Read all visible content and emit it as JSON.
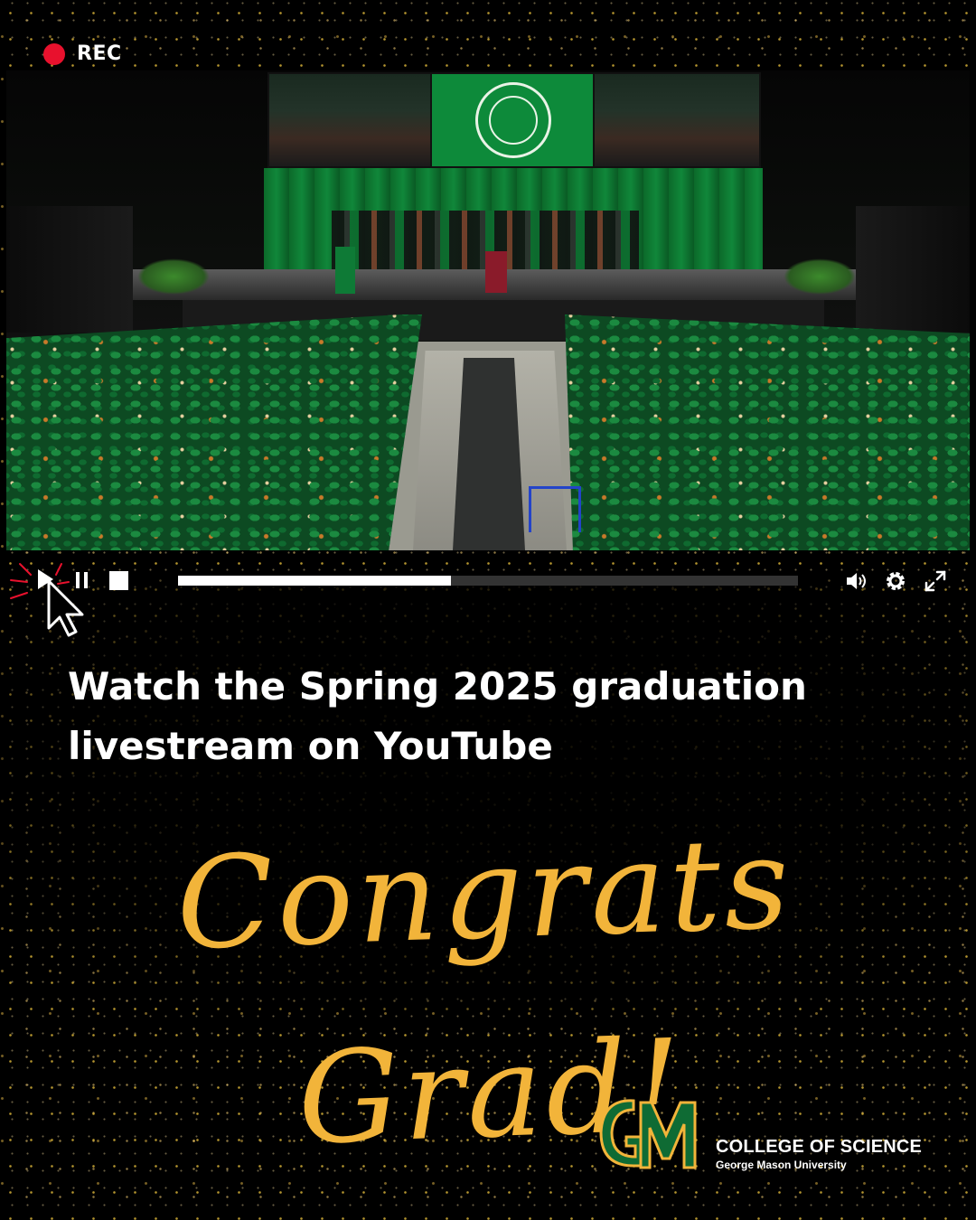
{
  "recording": {
    "label": "REC",
    "color": "#e8112d"
  },
  "video": {
    "description_icons": [
      "play-icon",
      "pause-icon",
      "stop-icon",
      "volume-icon",
      "settings-gear-icon",
      "fullscreen-icon"
    ],
    "progress_fraction": 0.44
  },
  "headline": {
    "line1": "Watch the Spring 2025 graduation",
    "line2": "livestream on YouTube"
  },
  "tagline": "Congrats Grad!",
  "branding": {
    "logo_letters": "GM",
    "college": "COLLEGE OF SCIENCE",
    "university": "George Mason University",
    "colors": {
      "green": "#0f6b34",
      "gold": "#f2b43a"
    }
  }
}
